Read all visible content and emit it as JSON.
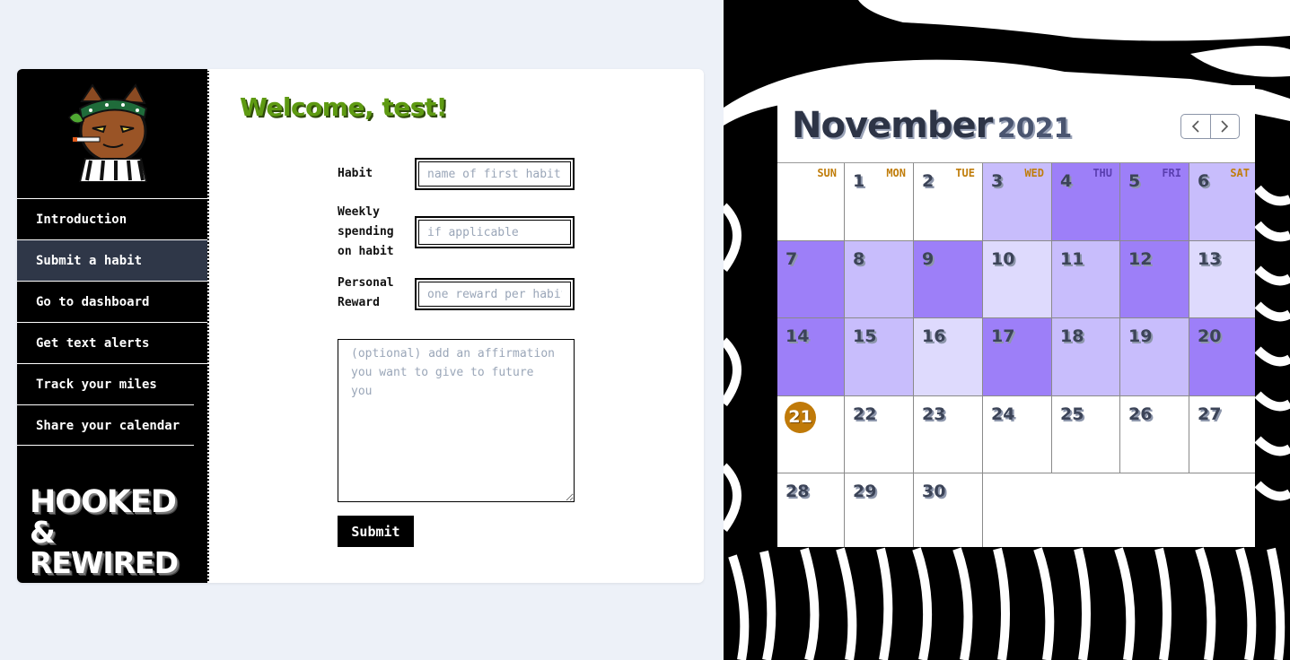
{
  "sidebar": {
    "nav": [
      {
        "label": "Introduction",
        "active": false
      },
      {
        "label": "Submit a habit",
        "active": true
      },
      {
        "label": "Go to dashboard",
        "active": false
      },
      {
        "label": "Get text alerts",
        "active": false
      },
      {
        "label": "Track your miles",
        "active": false
      },
      {
        "label": "Share your calendar",
        "active": false
      }
    ],
    "brand_line1": "HOOKED",
    "brand_line2": "& REWIRED"
  },
  "main": {
    "welcome": "Welcome, test!",
    "form": {
      "habit_label": "Habit",
      "habit_placeholder": "name of first habit",
      "spending_label_1": "Weekly",
      "spending_label_2": "spending",
      "spending_label_3": "on habit",
      "spending_placeholder": "if applicable",
      "reward_label_1": "Personal",
      "reward_label_2": "Reward",
      "reward_placeholder": "one reward per habit",
      "affirmation_placeholder": "(optional) add an affirmation you want to give to future you",
      "submit_label": "Submit"
    }
  },
  "calendar": {
    "month": "November",
    "year": "2021",
    "prev_icon": "chevron-left-icon",
    "next_icon": "chevron-right-icon",
    "weekdays": [
      "SUN",
      "MON",
      "TUE",
      "WED",
      "THU",
      "FRI",
      "SAT"
    ],
    "today": 21,
    "colors": {
      "level0": "#ffffff",
      "level1": "#dedafd",
      "level2": "#c8bdfc",
      "level3": "#9d7ff8",
      "today": "#c07a09"
    },
    "weeks": [
      [
        {
          "d": "",
          "l": 0
        },
        {
          "d": "1",
          "l": 0
        },
        {
          "d": "2",
          "l": 0
        },
        {
          "d": "3",
          "l": 2
        },
        {
          "d": "4",
          "l": 3
        },
        {
          "d": "5",
          "l": 3
        },
        {
          "d": "6",
          "l": 2
        }
      ],
      [
        {
          "d": "7",
          "l": 3
        },
        {
          "d": "8",
          "l": 2
        },
        {
          "d": "9",
          "l": 3
        },
        {
          "d": "10",
          "l": 1
        },
        {
          "d": "11",
          "l": 2
        },
        {
          "d": "12",
          "l": 3
        },
        {
          "d": "13",
          "l": 1
        }
      ],
      [
        {
          "d": "14",
          "l": 3
        },
        {
          "d": "15",
          "l": 2
        },
        {
          "d": "16",
          "l": 1
        },
        {
          "d": "17",
          "l": 3
        },
        {
          "d": "18",
          "l": 2
        },
        {
          "d": "19",
          "l": 2
        },
        {
          "d": "20",
          "l": 3
        }
      ],
      [
        {
          "d": "21",
          "l": 0
        },
        {
          "d": "22",
          "l": 0
        },
        {
          "d": "23",
          "l": 0
        },
        {
          "d": "24",
          "l": 0
        },
        {
          "d": "25",
          "l": 0
        },
        {
          "d": "26",
          "l": 0
        },
        {
          "d": "27",
          "l": 0
        }
      ],
      [
        {
          "d": "28",
          "l": 0
        },
        {
          "d": "29",
          "l": 0
        },
        {
          "d": "30",
          "l": 0
        }
      ]
    ]
  }
}
